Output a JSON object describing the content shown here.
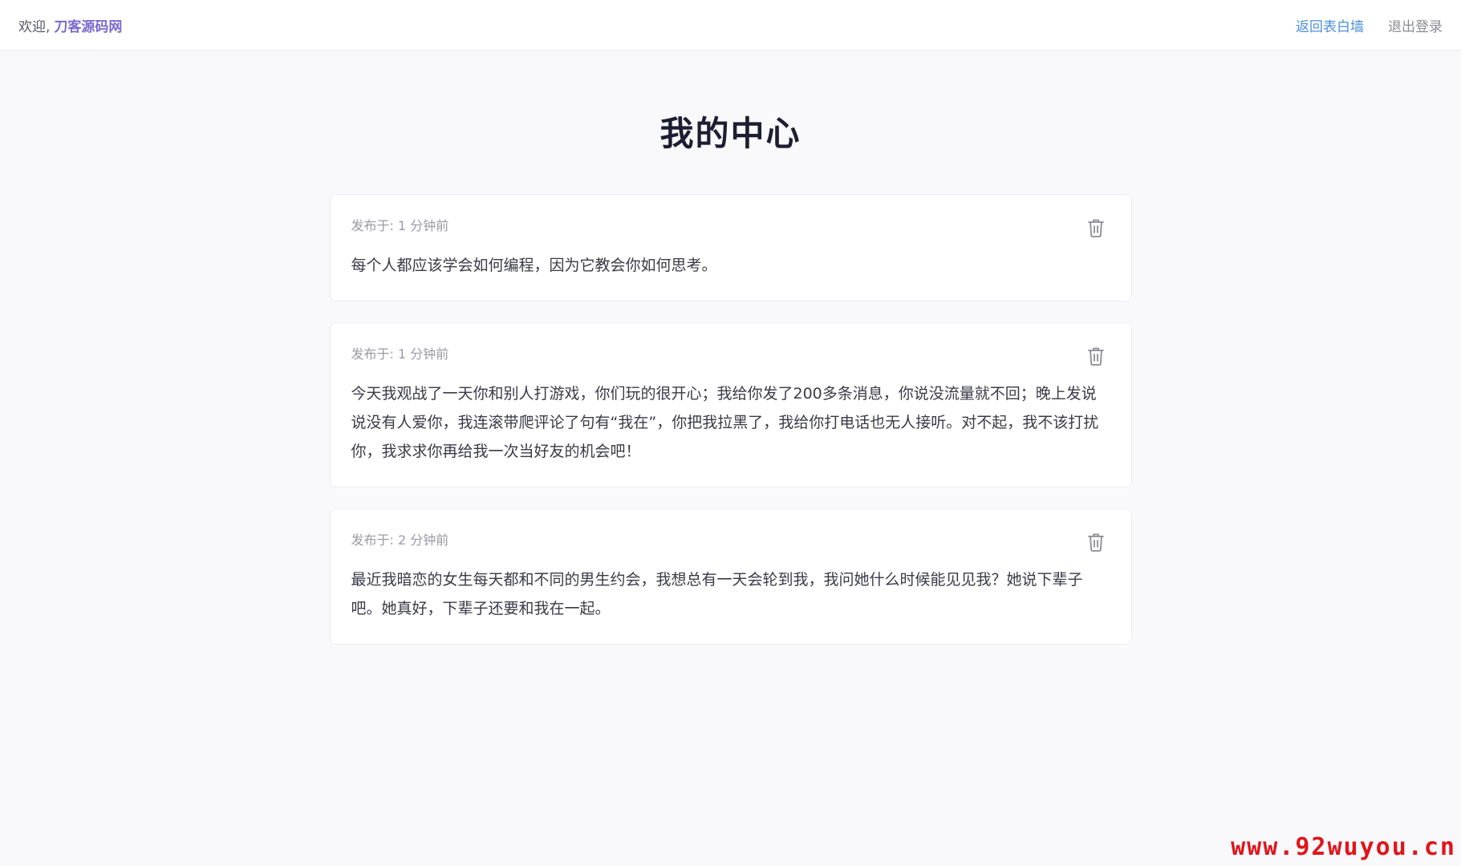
{
  "header": {
    "welcome_prefix": "欢迎,",
    "username": "刀客源码网",
    "back_link": "返回表白墙",
    "logout_link": "退出登录"
  },
  "page": {
    "title": "我的中心"
  },
  "posts": [
    {
      "meta": "发布于: 1 分钟前",
      "content": "每个人都应该学会如何编程，因为它教会你如何思考。",
      "delete_icon": "trash-icon"
    },
    {
      "meta": "发布于: 1 分钟前",
      "content": "今天我观战了一天你和别人打游戏，你们玩的很开心；我给你发了200多条消息，你说没流量就不回；晚上发说说没有人爱你，我连滚带爬评论了句有“我在”，你把我拉黑了，我给你打电话也无人接听。对不起，我不该打扰你，我求求你再给我一次当好友的机会吧！",
      "delete_icon": "trash-icon"
    },
    {
      "meta": "发布于: 2 分钟前",
      "content": "最近我暗恋的女生每天都和不同的男生约会，我想总有一天会轮到我，我问她什么时候能见见我？她说下辈子吧。她真好，下辈子还要和我在一起。",
      "delete_icon": "trash-icon"
    }
  ],
  "watermark": "www.92wuyou.cn",
  "colors": {
    "username": "#7a6ad0",
    "back_link": "#4a8fd8",
    "logout_link": "#8a8a96",
    "watermark": "#e0151b",
    "background": "#f9f9fc"
  }
}
